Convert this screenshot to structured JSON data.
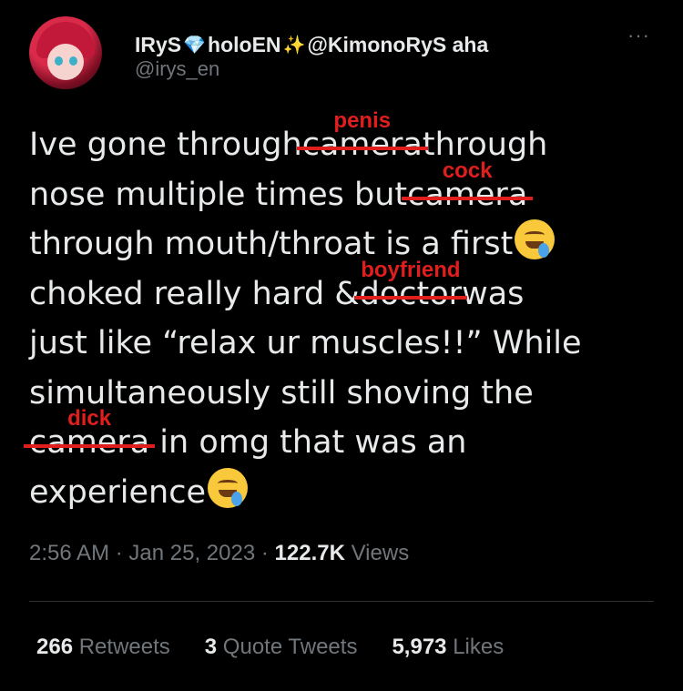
{
  "header": {
    "display_name_1": "IRyS",
    "display_name_2": "holoEN",
    "display_name_3": "@KimonoRyS aha",
    "diamond_icon": "💎",
    "sparkle_icon": "✨",
    "handle": "@irys_en",
    "more_icon": "···"
  },
  "tweet": {
    "l1_a": "Ive gone through",
    "l1_orig": "camera",
    "l1_over": "penis",
    "l1_b": "through",
    "l2_a": "nose multiple times but",
    "l2_orig": "camera",
    "l2_over": "cock",
    "l3_a": "through mouth/throat is a first",
    "l4_a": "choked really hard &",
    "l4_orig": "doctor",
    "l4_over": "boyfriend",
    "l4_b": "was",
    "l5_a": "just like “relax ur muscles!!” While",
    "l6_a": "simultaneously still shoving the",
    "l7_orig": "camera",
    "l7_over": "dick",
    "l7_b": "in omg that was an",
    "l8_a": "experience"
  },
  "meta": {
    "time": "2:56 AM",
    "sep1": "·",
    "date": "Jan 25, 2023",
    "sep2": "·",
    "views_num": "122.7K",
    "views_label": "Views"
  },
  "stats": {
    "retweets_num": "266",
    "retweets_label": "Retweets",
    "quotes_num": "3",
    "quotes_label": "Quote Tweets",
    "likes_num": "5,973",
    "likes_label": "Likes"
  }
}
